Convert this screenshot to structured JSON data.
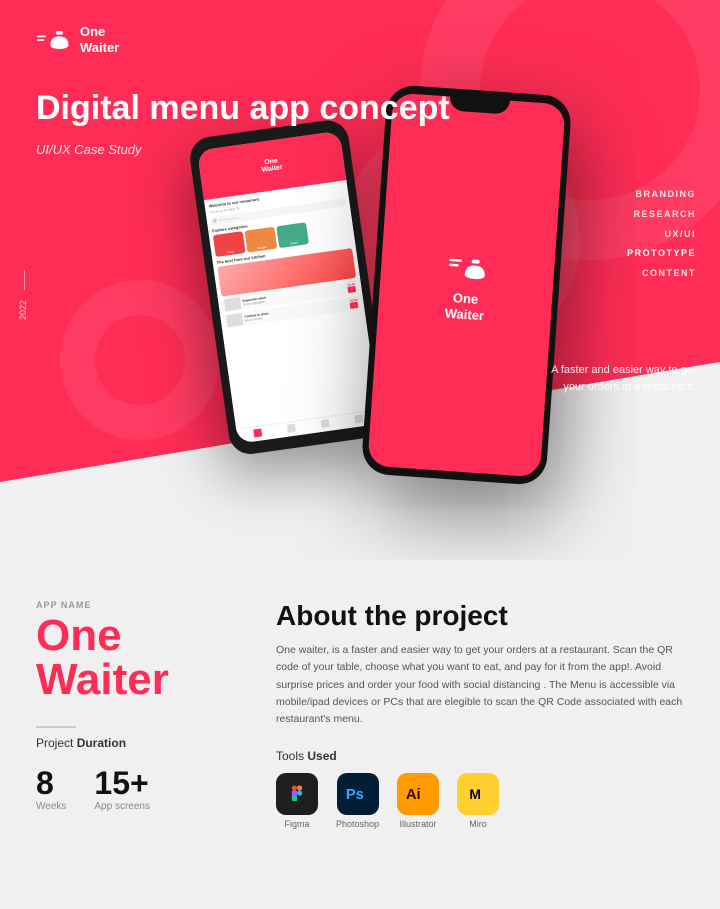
{
  "logo": {
    "line1": "One",
    "line2": "Waiter"
  },
  "hero": {
    "title": "Digital menu app concept",
    "subtitle": "UI/UX Case Study",
    "year": "2022",
    "tagline_line1": "A faster and easier way to get",
    "tagline_line2": "your orders at a restaurant."
  },
  "nav": {
    "items": [
      {
        "label": "BRANDING",
        "active": false
      },
      {
        "label": "RESEARCH",
        "active": false
      },
      {
        "label": "UX/UI",
        "active": false
      },
      {
        "label": "PROTOTYPE",
        "active": true
      },
      {
        "label": "CONTENT",
        "active": false
      }
    ]
  },
  "app_name_label": "APP NAME",
  "app_big_name": "One Waiter",
  "about": {
    "title": "About the project",
    "text": "One waiter, is a faster and easier way to get your orders at a restaurant. Scan the QR code of your table, choose what you want to eat, and pay for it from the app!. Avoid surprise prices and order your food with social distancing . The Menu is accessible via mobile/ipad devices or PCs that are elegible to scan the QR Code associated with each restaurant's menu."
  },
  "duration": {
    "label_pre": "Project ",
    "label_bold": "Duration",
    "weeks_number": "8",
    "weeks_label": "Weeks",
    "screens_number": "15+",
    "screens_label": "App screens"
  },
  "tools": {
    "label_pre": "Tools ",
    "label_bold": "Used",
    "items": [
      {
        "name": "Figma",
        "icon_type": "figma"
      },
      {
        "name": "Photoshop",
        "icon_type": "ps"
      },
      {
        "name": "Illustrator",
        "icon_type": "ai"
      },
      {
        "name": "Miro",
        "icon_type": "miro"
      }
    ]
  },
  "phone_app": {
    "header_title": "Welcome to our restaurant",
    "header_sub": "You are at the table 2b",
    "search_placeholder": "Find your meal",
    "explore_title": "Explore categories",
    "cats": [
      "Pizza",
      "Burger",
      "Sushi"
    ],
    "best_title": "The best from our kitchen",
    "items": [
      {
        "name": "Vegetarian salad",
        "price": "£5.00"
      },
      {
        "name": "Combos to share",
        "price": "£6.00"
      }
    ]
  }
}
